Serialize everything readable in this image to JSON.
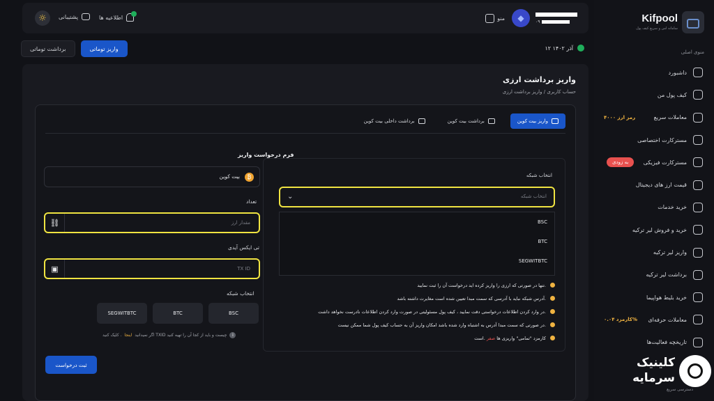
{
  "sidebar": {
    "brand": "Kifpool",
    "tagline": "سامانه امن و سریع کیف پول",
    "menu_title": "منوی اصلی",
    "items": [
      {
        "label": "داشبورد",
        "icon": "grid-icon"
      },
      {
        "label": "کیف پول من",
        "icon": "wallet-icon"
      },
      {
        "label": "معاملات سریع",
        "icon": "arrow-up-right-icon",
        "extra": "۴۰۰۰ رمز ارز"
      },
      {
        "label": "مسترکارت اختصاصی",
        "icon": "card-icon"
      },
      {
        "label": "مسترکارت فیزیکی",
        "icon": "card-icon",
        "pill": "به زودی"
      },
      {
        "label": "قیمت ارز های دیجیتال",
        "icon": "chart-icon"
      },
      {
        "label": "خرید خدمات",
        "icon": "document-icon"
      },
      {
        "label": "خرید و فروش لیر ترکیه",
        "icon": "exchange-icon"
      },
      {
        "label": "واریز لیر ترکیه",
        "icon": "arrow-down-icon"
      },
      {
        "label": "برداشت لیر ترکیه",
        "icon": "arrow-up-icon"
      },
      {
        "label": "خرید بلیط هواپیما",
        "icon": "plane-icon"
      },
      {
        "label": "معاملات حرفه‌ای",
        "icon": "chart-icon",
        "extra": "کارمزد ۰.۰۴%"
      },
      {
        "label": "تاریخچه فعالیت‌ها",
        "icon": "history-icon"
      }
    ],
    "bottom_note": "دسترسی سریع"
  },
  "topbar": {
    "support": "پشتیبانی",
    "notifications": "اطلاعیه ها",
    "menu": "منو",
    "user_suffix": "۰۹"
  },
  "top_tabs": {
    "auto_deposit": "واریز توماتی",
    "auto_withdraw": "برداشت توماتی"
  },
  "date": "۱۲ آذر ۱۴۰۲",
  "page": {
    "title": "واریز برداشت ارزی",
    "breadcrumb_home": "حساب کاربری",
    "breadcrumb_sep": "/",
    "breadcrumb_current": "واریز برداشت ارزی"
  },
  "subtabs": {
    "deposit_btc": "واریز بیت کوین",
    "withdraw_btc": "برداشت بیت کوین",
    "internal_withdraw": "برداشت داخلی بیت کوین"
  },
  "network": {
    "label": "انتخاب شبکه",
    "placeholder": "انتخاب شبکه",
    "options": [
      "BSC",
      "BTC",
      "SEGWITBTC"
    ]
  },
  "notes": [
    "تنها در صورتی که ارزی را واریز کرده اید درخواست آن را ثبت نمایید.",
    "آدرس شبکه نباید با آدرسی که سمت مبدا تعیین شده است مغایرت داشته باشد.",
    "در وارد کردن اطلاعات درخواستی دقت نمایید ، کیف پول مسئولیتی در صورت وارد کردن اطلاعات نادرست نخواهد داشت.",
    "در صورتی که سمت مبدا آدرس به اشتباه وارد شده باشد امکان واریز آن به حساب کیف پول شما ممکن نیست."
  ],
  "fee_note": {
    "before": "کارمزد \"تمامی\" واریزی ها",
    "highlight": "صفر",
    "after": "است."
  },
  "form": {
    "title": "فرم درخواست واریز",
    "currency": "بیت کوین",
    "amount_label": "تعداد",
    "amount_placeholder": "مقدار ارز",
    "txid_label": "تی ایکس آیدی",
    "txid_placeholder": "TX ID",
    "network_label": "انتخاب شبکه",
    "network_options": [
      "BSC",
      "BTC",
      "SEGWITBTC"
    ],
    "hint_before": "اگر نمیدانید TXID چیست و باید از کجا آن را تهیه کنید",
    "hint_link": "اینجا",
    "hint_after": "کلیک کنید .",
    "submit": "ثبت درخواست"
  },
  "watermark": {
    "line1": "کلینیک",
    "line2": "سرمایه"
  }
}
